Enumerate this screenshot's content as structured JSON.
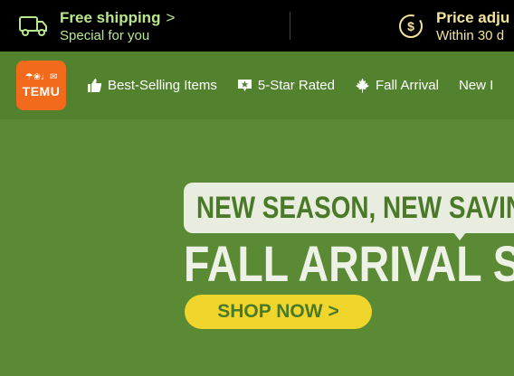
{
  "promo": {
    "shipping": {
      "title": "Free shipping",
      "subtitle": "Special for you",
      "icon": "truck-icon",
      "chevron": ">"
    },
    "price": {
      "title": "Price adju",
      "subtitle": "Within 30 d",
      "icon": "dollar-badge-icon"
    }
  },
  "nav": {
    "logo": {
      "text": "TEMU",
      "icons": "☂❀♩✉"
    },
    "items": [
      {
        "label": "Best-Selling Items",
        "icon": "thumbs-up-icon"
      },
      {
        "label": "5-Star Rated",
        "icon": "star-badge-icon"
      },
      {
        "label": "Fall Arrival",
        "icon": "maple-leaf-icon"
      },
      {
        "label": "New I",
        "icon": ""
      }
    ]
  },
  "hero": {
    "bubble_text": "NEW SEASON, NEW SAVING",
    "title": "FALL ARRIVAL SA",
    "cta": {
      "label": "SHOP NOW",
      "chevron": ">"
    }
  },
  "colors": {
    "promo_bg": "#000000",
    "promo_text": "#b8e88c",
    "nav_bg": "#53822f",
    "hero_bg": "#5a8a34",
    "logo_bg": "#f26a1b",
    "cta_bg": "#f0d62c",
    "cta_text": "#4a7a28"
  }
}
